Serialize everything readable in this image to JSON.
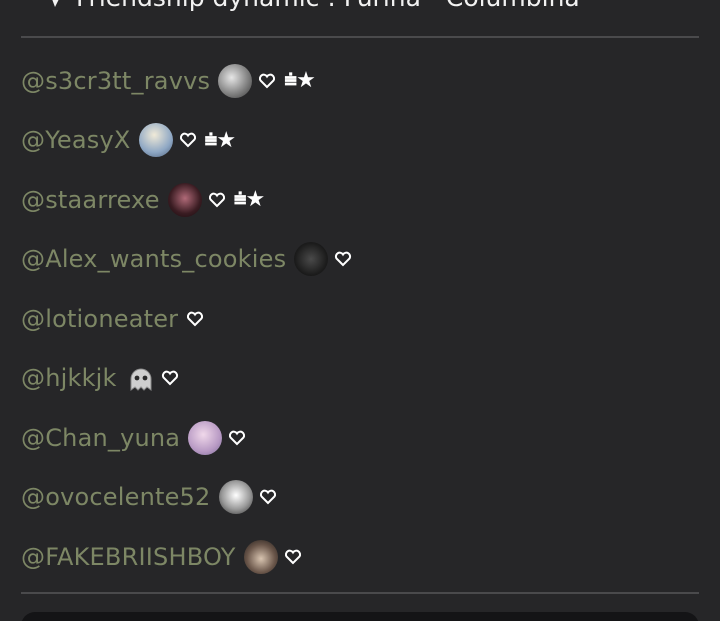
{
  "header": {
    "title": "Friendship dynamic : Furina - Columbina",
    "icon": "paper-plane-icon"
  },
  "mentions": [
    {
      "handle": "@s3cr3tt_ravvs",
      "avatar_color": "#8a8a8a",
      "decoration": "⩧★"
    },
    {
      "handle": "@YeasyX",
      "avatar_color": "#a9b8c9",
      "decoration": "⩧★"
    },
    {
      "handle": "@staarrexe",
      "avatar_color": "#3a1c22",
      "decoration": "⩧★"
    },
    {
      "handle": "@Alex_wants_cookies",
      "avatar_color": "#202020",
      "decoration": ""
    },
    {
      "handle": "@lotioneater",
      "avatar_color": "",
      "decoration": ""
    },
    {
      "handle": "@hjkkjk",
      "avatar_color": "",
      "decoration": ""
    },
    {
      "handle": "@Chan_yuna",
      "avatar_color": "#c9a9c9",
      "decoration": ""
    },
    {
      "handle": "@ovocelente52",
      "avatar_color": "#d8d8d8",
      "decoration": ""
    },
    {
      "handle": "@FAKEBRIISHBOY",
      "avatar_color": "#4a3e38",
      "decoration": ""
    }
  ],
  "colors": {
    "background": "#262628",
    "handle": "#7d8765",
    "divider": "#4a4a4c",
    "text": "#f2f2f2"
  }
}
